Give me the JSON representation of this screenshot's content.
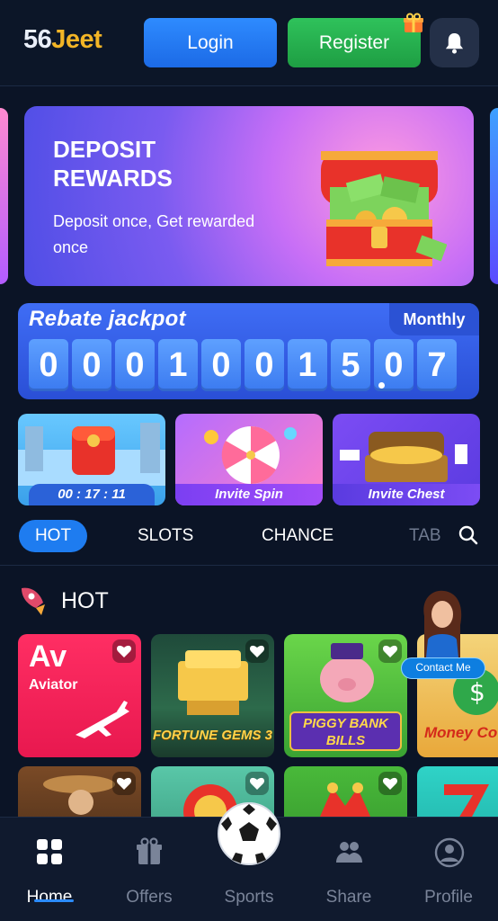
{
  "header": {
    "logo_num": "56",
    "logo_text": "Jeet",
    "login_label": "Login",
    "register_label": "Register",
    "icons": [
      "gift-icon",
      "bell-icon"
    ]
  },
  "banner": {
    "title": "DEPOSIT REWARDS",
    "subtitle": "Deposit once, Get rewarded once"
  },
  "jackpot": {
    "title": "Rebate jackpot",
    "period": "Monthly",
    "digits": [
      "0",
      "0",
      "0",
      "1",
      "0",
      "0",
      "1",
      "5",
      "0",
      "7"
    ]
  },
  "promos": [
    {
      "label": "00 : 17 : 11"
    },
    {
      "label": "Invite Spin"
    },
    {
      "label": "Invite Chest"
    }
  ],
  "tabs": {
    "items": [
      "HOT",
      "SLOTS",
      "CHANCE",
      "TAB"
    ],
    "active": "HOT"
  },
  "hot_section": {
    "label": "HOT",
    "games": [
      {
        "logo": "Av",
        "name": "Aviator"
      },
      {
        "name": "FORTUNE GEMS 3"
      },
      {
        "name": "PIGGY BANK BILLS"
      },
      {
        "name": "Money Co"
      }
    ],
    "contact_label": "Contact Me"
  },
  "bottom_nav": {
    "items": [
      {
        "label": "Home",
        "icon": "grid-icon"
      },
      {
        "label": "Offers",
        "icon": "gift-icon"
      },
      {
        "label": "Sports",
        "icon": "soccer-ball-icon"
      },
      {
        "label": "Share",
        "icon": "people-icon"
      },
      {
        "label": "Profile",
        "icon": "user-icon"
      }
    ],
    "active": "Home"
  },
  "colors": {
    "background": "#0b1426",
    "login": "#1c6ae6",
    "register": "#1e9e43",
    "accent_blue": "#1e7cf0",
    "logo_gold": "#f3b526"
  }
}
